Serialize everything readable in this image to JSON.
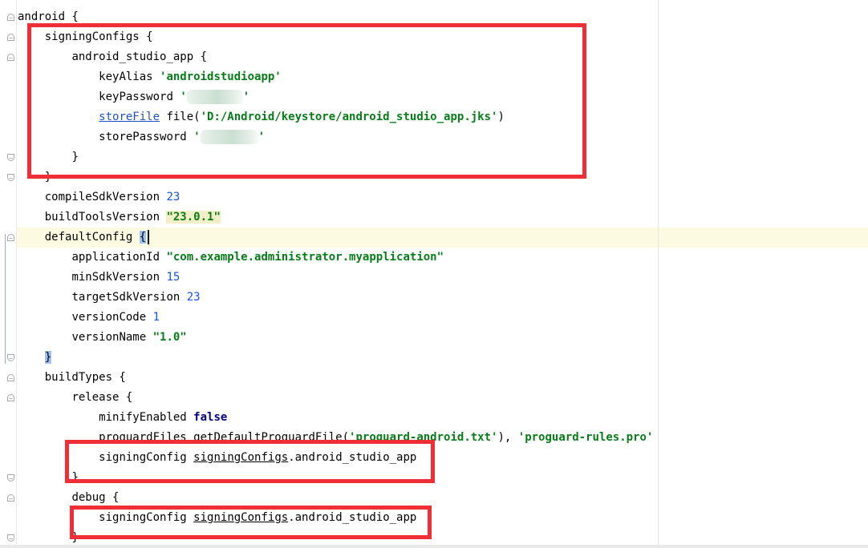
{
  "editor": {
    "lines": [
      {
        "indent": "",
        "segments": [
          {
            "t": "android {"
          }
        ]
      },
      {
        "indent": "    ",
        "segments": [
          {
            "t": "signingConfigs {"
          }
        ]
      },
      {
        "indent": "        ",
        "segments": [
          {
            "t": "android_studio_app {"
          }
        ]
      },
      {
        "indent": "            ",
        "segments": [
          {
            "t": "keyAlias "
          },
          {
            "t": "'androidstudioapp'",
            "c": "str"
          }
        ]
      },
      {
        "indent": "            ",
        "segments": [
          {
            "t": "keyPassword "
          },
          {
            "t": "'",
            "c": "str"
          },
          {
            "redact": 70
          },
          {
            "t": "'",
            "c": "str"
          }
        ]
      },
      {
        "indent": "            ",
        "segments": [
          {
            "t": "storeFile",
            "c": "link"
          },
          {
            "t": " file("
          },
          {
            "t": "'D:/Android/keystore/android_studio_app.jks'",
            "c": "str"
          },
          {
            "t": ")"
          }
        ]
      },
      {
        "indent": "            ",
        "segments": [
          {
            "t": "storePassword "
          },
          {
            "t": "'",
            "c": "str"
          },
          {
            "redact": 72
          },
          {
            "t": "'",
            "c": "str"
          }
        ]
      },
      {
        "indent": "        ",
        "segments": [
          {
            "t": "}"
          }
        ]
      },
      {
        "indent": "    ",
        "segments": [
          {
            "t": "}"
          }
        ]
      },
      {
        "indent": "    ",
        "segments": [
          {
            "t": "compileSdkVersion "
          },
          {
            "t": "23",
            "c": "num"
          }
        ]
      },
      {
        "indent": "    ",
        "segments": [
          {
            "t": "buildToolsVersion "
          },
          {
            "t": "\"23.0.1\"",
            "c": "str sel-str"
          }
        ]
      },
      {
        "indent": "    ",
        "segments": [
          {
            "t": "defaultConfig "
          },
          {
            "t": "{",
            "c": "brace-match"
          },
          {
            "caret": true
          }
        ]
      },
      {
        "indent": "        ",
        "segments": [
          {
            "t": "applicationId "
          },
          {
            "t": "\"com.example.administrator.myapplication\"",
            "c": "str"
          }
        ]
      },
      {
        "indent": "        ",
        "segments": [
          {
            "t": "minSdkVersion "
          },
          {
            "t": "15",
            "c": "num"
          }
        ]
      },
      {
        "indent": "        ",
        "segments": [
          {
            "t": "targetSdkVersion "
          },
          {
            "t": "23",
            "c": "num"
          }
        ]
      },
      {
        "indent": "        ",
        "segments": [
          {
            "t": "versionCode "
          },
          {
            "t": "1",
            "c": "num"
          }
        ]
      },
      {
        "indent": "        ",
        "segments": [
          {
            "t": "versionName "
          },
          {
            "t": "\"1.0\"",
            "c": "str"
          }
        ]
      },
      {
        "indent": "    ",
        "segments": [
          {
            "t": "}",
            "c": "brace-match"
          }
        ]
      },
      {
        "indent": "    ",
        "segments": [
          {
            "t": "buildTypes {"
          }
        ]
      },
      {
        "indent": "        ",
        "segments": [
          {
            "t": "release {"
          }
        ]
      },
      {
        "indent": "            ",
        "segments": [
          {
            "t": "minifyEnabled "
          },
          {
            "t": "false",
            "c": "kw"
          }
        ]
      },
      {
        "indent": "            ",
        "segments": [
          {
            "t": "proguardFiles getDefaultProguardFile("
          },
          {
            "t": "'proguard-android.txt'",
            "c": "str"
          },
          {
            "t": "), "
          },
          {
            "t": "'proguard-rules.pro'",
            "c": "str"
          }
        ]
      },
      {
        "indent": "            ",
        "segments": [
          {
            "t": "signingConfig "
          },
          {
            "t": "signingConfigs",
            "c": "uline"
          },
          {
            "t": ".android_studio_app"
          }
        ]
      },
      {
        "indent": "        ",
        "segments": [
          {
            "t": "}"
          }
        ]
      },
      {
        "indent": "        ",
        "segments": [
          {
            "t": "debug {"
          }
        ]
      },
      {
        "indent": "            ",
        "segments": [
          {
            "t": "signingConfig "
          },
          {
            "t": "signingConfigs",
            "c": "uline"
          },
          {
            "t": ".android_studio_app"
          }
        ]
      },
      {
        "indent": "        ",
        "segments": [
          {
            "t": "}"
          }
        ]
      }
    ]
  },
  "gutter": {
    "fold_markers": [
      {
        "line": 0,
        "kind": "start",
        "glyph": "−"
      },
      {
        "line": 1,
        "kind": "start",
        "glyph": "−"
      },
      {
        "line": 2,
        "kind": "start",
        "glyph": "−"
      },
      {
        "line": 7,
        "kind": "end",
        "glyph": "−"
      },
      {
        "line": 8,
        "kind": "end",
        "glyph": "−"
      },
      {
        "line": 11,
        "kind": "start",
        "glyph": "−"
      },
      {
        "line": 17,
        "kind": "end",
        "glyph": "−"
      },
      {
        "line": 18,
        "kind": "start",
        "glyph": "−"
      },
      {
        "line": 19,
        "kind": "start",
        "glyph": "−"
      },
      {
        "line": 23,
        "kind": "end",
        "glyph": "−"
      },
      {
        "line": 24,
        "kind": "start",
        "glyph": "−"
      },
      {
        "line": 26,
        "kind": "end",
        "glyph": "−"
      }
    ]
  },
  "annotations": {
    "color": "#ef2f35",
    "boxes": [
      {
        "name": "signing-configs-highlight"
      },
      {
        "name": "release-signing-config-highlight"
      },
      {
        "name": "debug-signing-config-highlight"
      }
    ]
  },
  "colors": {
    "string": "#067d17",
    "number": "#1750eb",
    "keyword": "#000080",
    "link": "#2050c8",
    "current_line": "#fdfae2",
    "brace_match": "#9ec1f1"
  }
}
